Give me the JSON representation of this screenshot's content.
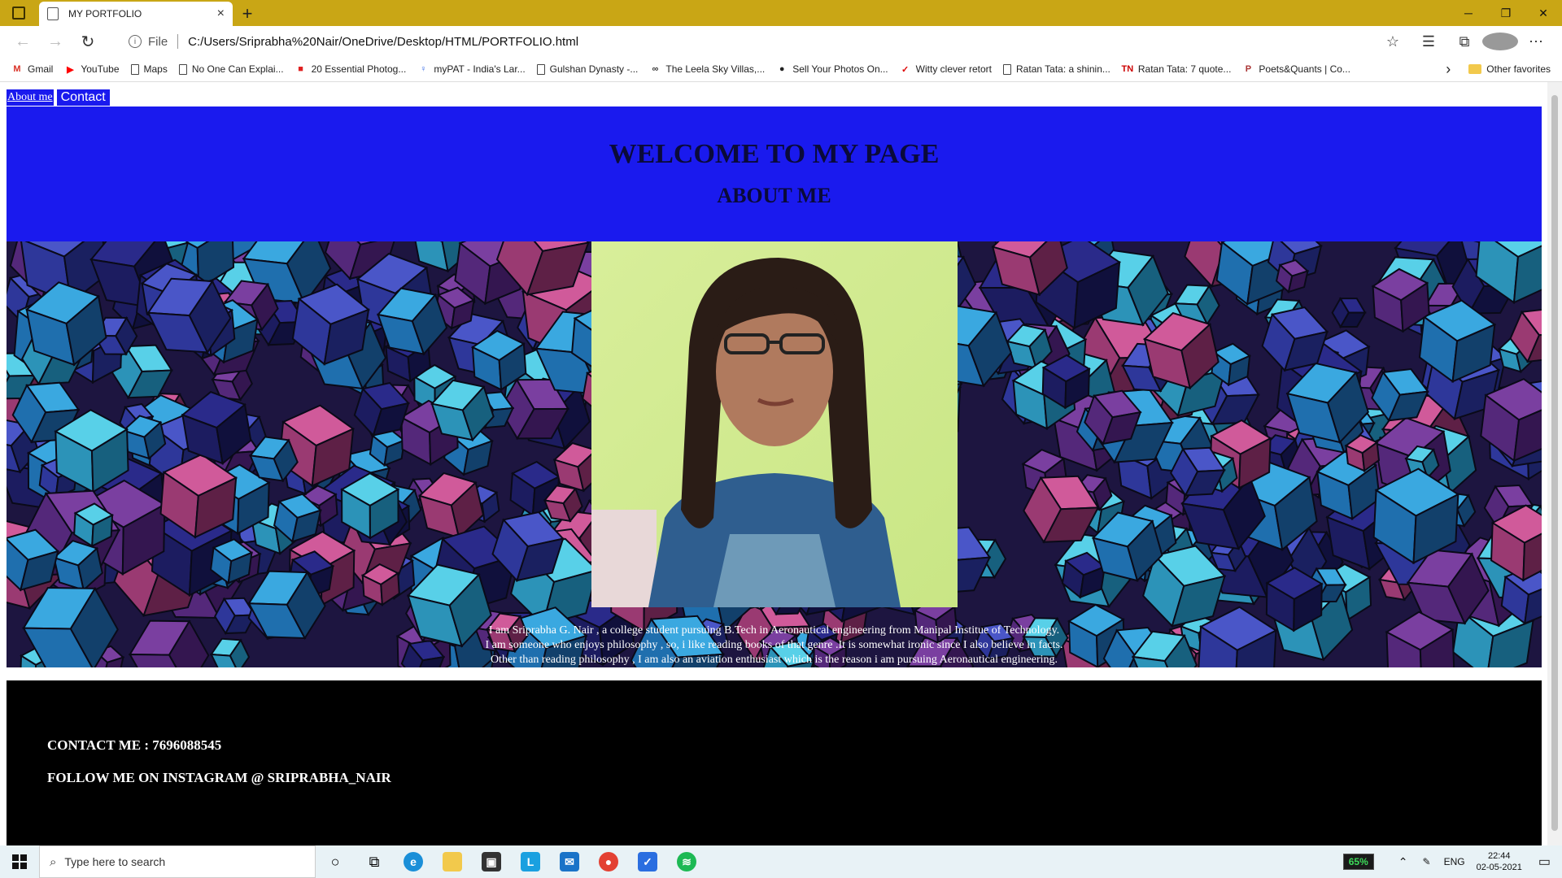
{
  "browser": {
    "tab_title": "MY PORTFOLIO",
    "tab_close": "×",
    "new_tab": "+",
    "file_label": "File",
    "url": "C:/Users/Sriprabha%20Nair/OneDrive/Desktop/HTML/PORTFOLIO.html",
    "bookmarks": [
      {
        "label": "Gmail",
        "icon": "gmail-icon",
        "color": "#d93025",
        "glyph": "M"
      },
      {
        "label": "YouTube",
        "icon": "youtube-icon",
        "color": "#ff0000",
        "glyph": "▶"
      },
      {
        "label": "Maps",
        "icon": "page-icon"
      },
      {
        "label": "No One Can Explai...",
        "icon": "page-icon"
      },
      {
        "label": "20 Essential Photog...",
        "icon": "red-square-icon",
        "color": "#e02020",
        "glyph": "■"
      },
      {
        "label": "myPAT - India's Lar...",
        "icon": "mypat-icon",
        "color": "#3a6ee8",
        "glyph": "♀"
      },
      {
        "label": "Gulshan Dynasty -...",
        "icon": "page-icon"
      },
      {
        "label": "The Leela Sky Villas,...",
        "icon": "tripadvisor-icon",
        "color": "#333",
        "glyph": "∞"
      },
      {
        "label": "Sell Your Photos On...",
        "icon": "camera-icon",
        "color": "#222",
        "glyph": "●"
      },
      {
        "label": "Witty clever retort",
        "icon": "quote-icon",
        "color": "#d00",
        "glyph": "✓"
      },
      {
        "label": "Ratan Tata: a shinin...",
        "icon": "page-icon"
      },
      {
        "label": "Ratan Tata: 7 quote...",
        "icon": "tn-icon",
        "color": "#c00",
        "glyph": "TN"
      },
      {
        "label": "Poets&Quants | Co...",
        "icon": "pq-icon",
        "color": "#a33",
        "glyph": "P"
      }
    ],
    "bookmarks_more": "›",
    "other_favorites": "Other favorites"
  },
  "page": {
    "nav_about": "About me",
    "nav_contact": "Contact",
    "welcome": "WELCOME TO MY PAGE",
    "about_heading": "ABOUT ME",
    "about_lines": [
      "I am Sriprabha G. Nair , a college student pursuing B.Tech in Aeronautical engineering from Manipal Institue of Technology.",
      "I am someone who enjoys philosophy , so, i like reading books of that genre .It is somewhat ironic since I also believe in facts.",
      "Other than reading philosophy , I am also an aviation enthusiast which is the reason i am pursuing Aeronautical engineering."
    ],
    "contact": "CONTACT ME : 7696088545",
    "instagram": "FOLLOW ME ON INSTAGRAM @ SRIPRABHA_NAIR",
    "colors": {
      "header_bg": "#1a1aee",
      "footer_bg": "#000000"
    }
  },
  "taskbar": {
    "search_placeholder": "Type here to search",
    "battery": "65%",
    "lang": "ENG",
    "time": "22:44",
    "date": "02-05-2021"
  }
}
